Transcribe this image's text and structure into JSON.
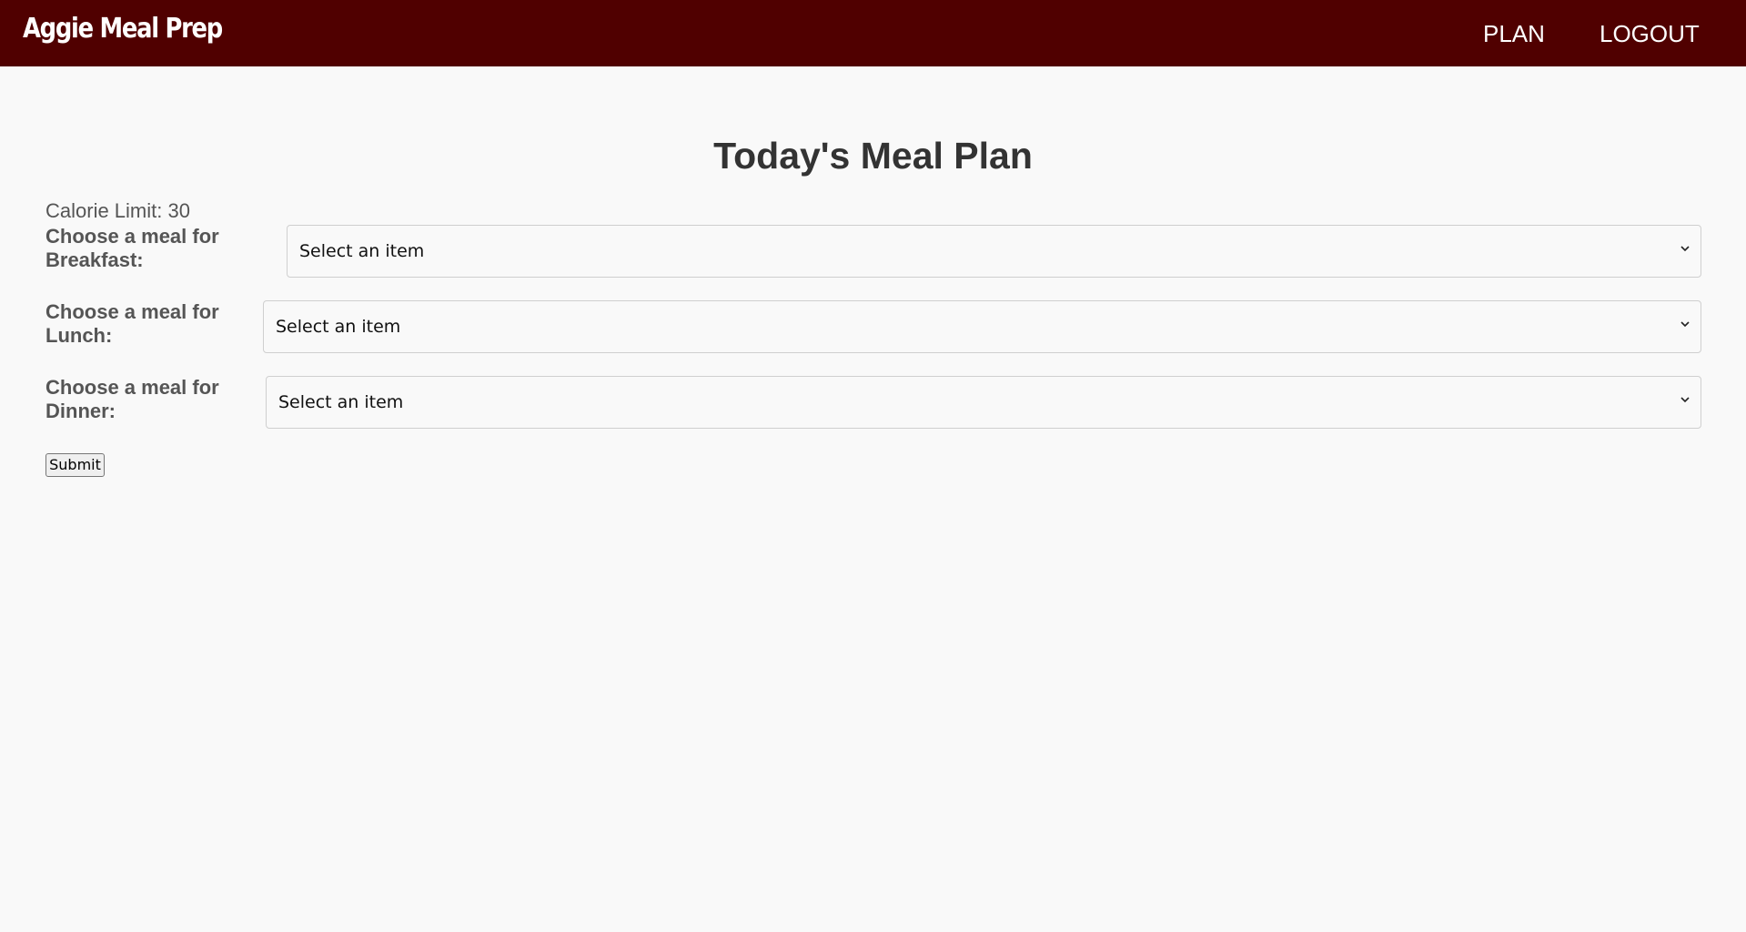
{
  "header": {
    "brand": "Aggie Meal Prep",
    "nav": {
      "plan": "PLAN",
      "logout": "LOGOUT"
    },
    "background_color": "#500000"
  },
  "main": {
    "title": "Today's Meal Plan",
    "calorie_limit": "Calorie Limit: 30",
    "meals": [
      {
        "label": "Choose a meal for Breakfast:",
        "selected": "Select an item"
      },
      {
        "label": "Choose a meal for Lunch:",
        "selected": "Select an item"
      },
      {
        "label": "Choose a meal for Dinner:",
        "selected": "Select an item"
      }
    ],
    "submit_label": "Submit"
  }
}
